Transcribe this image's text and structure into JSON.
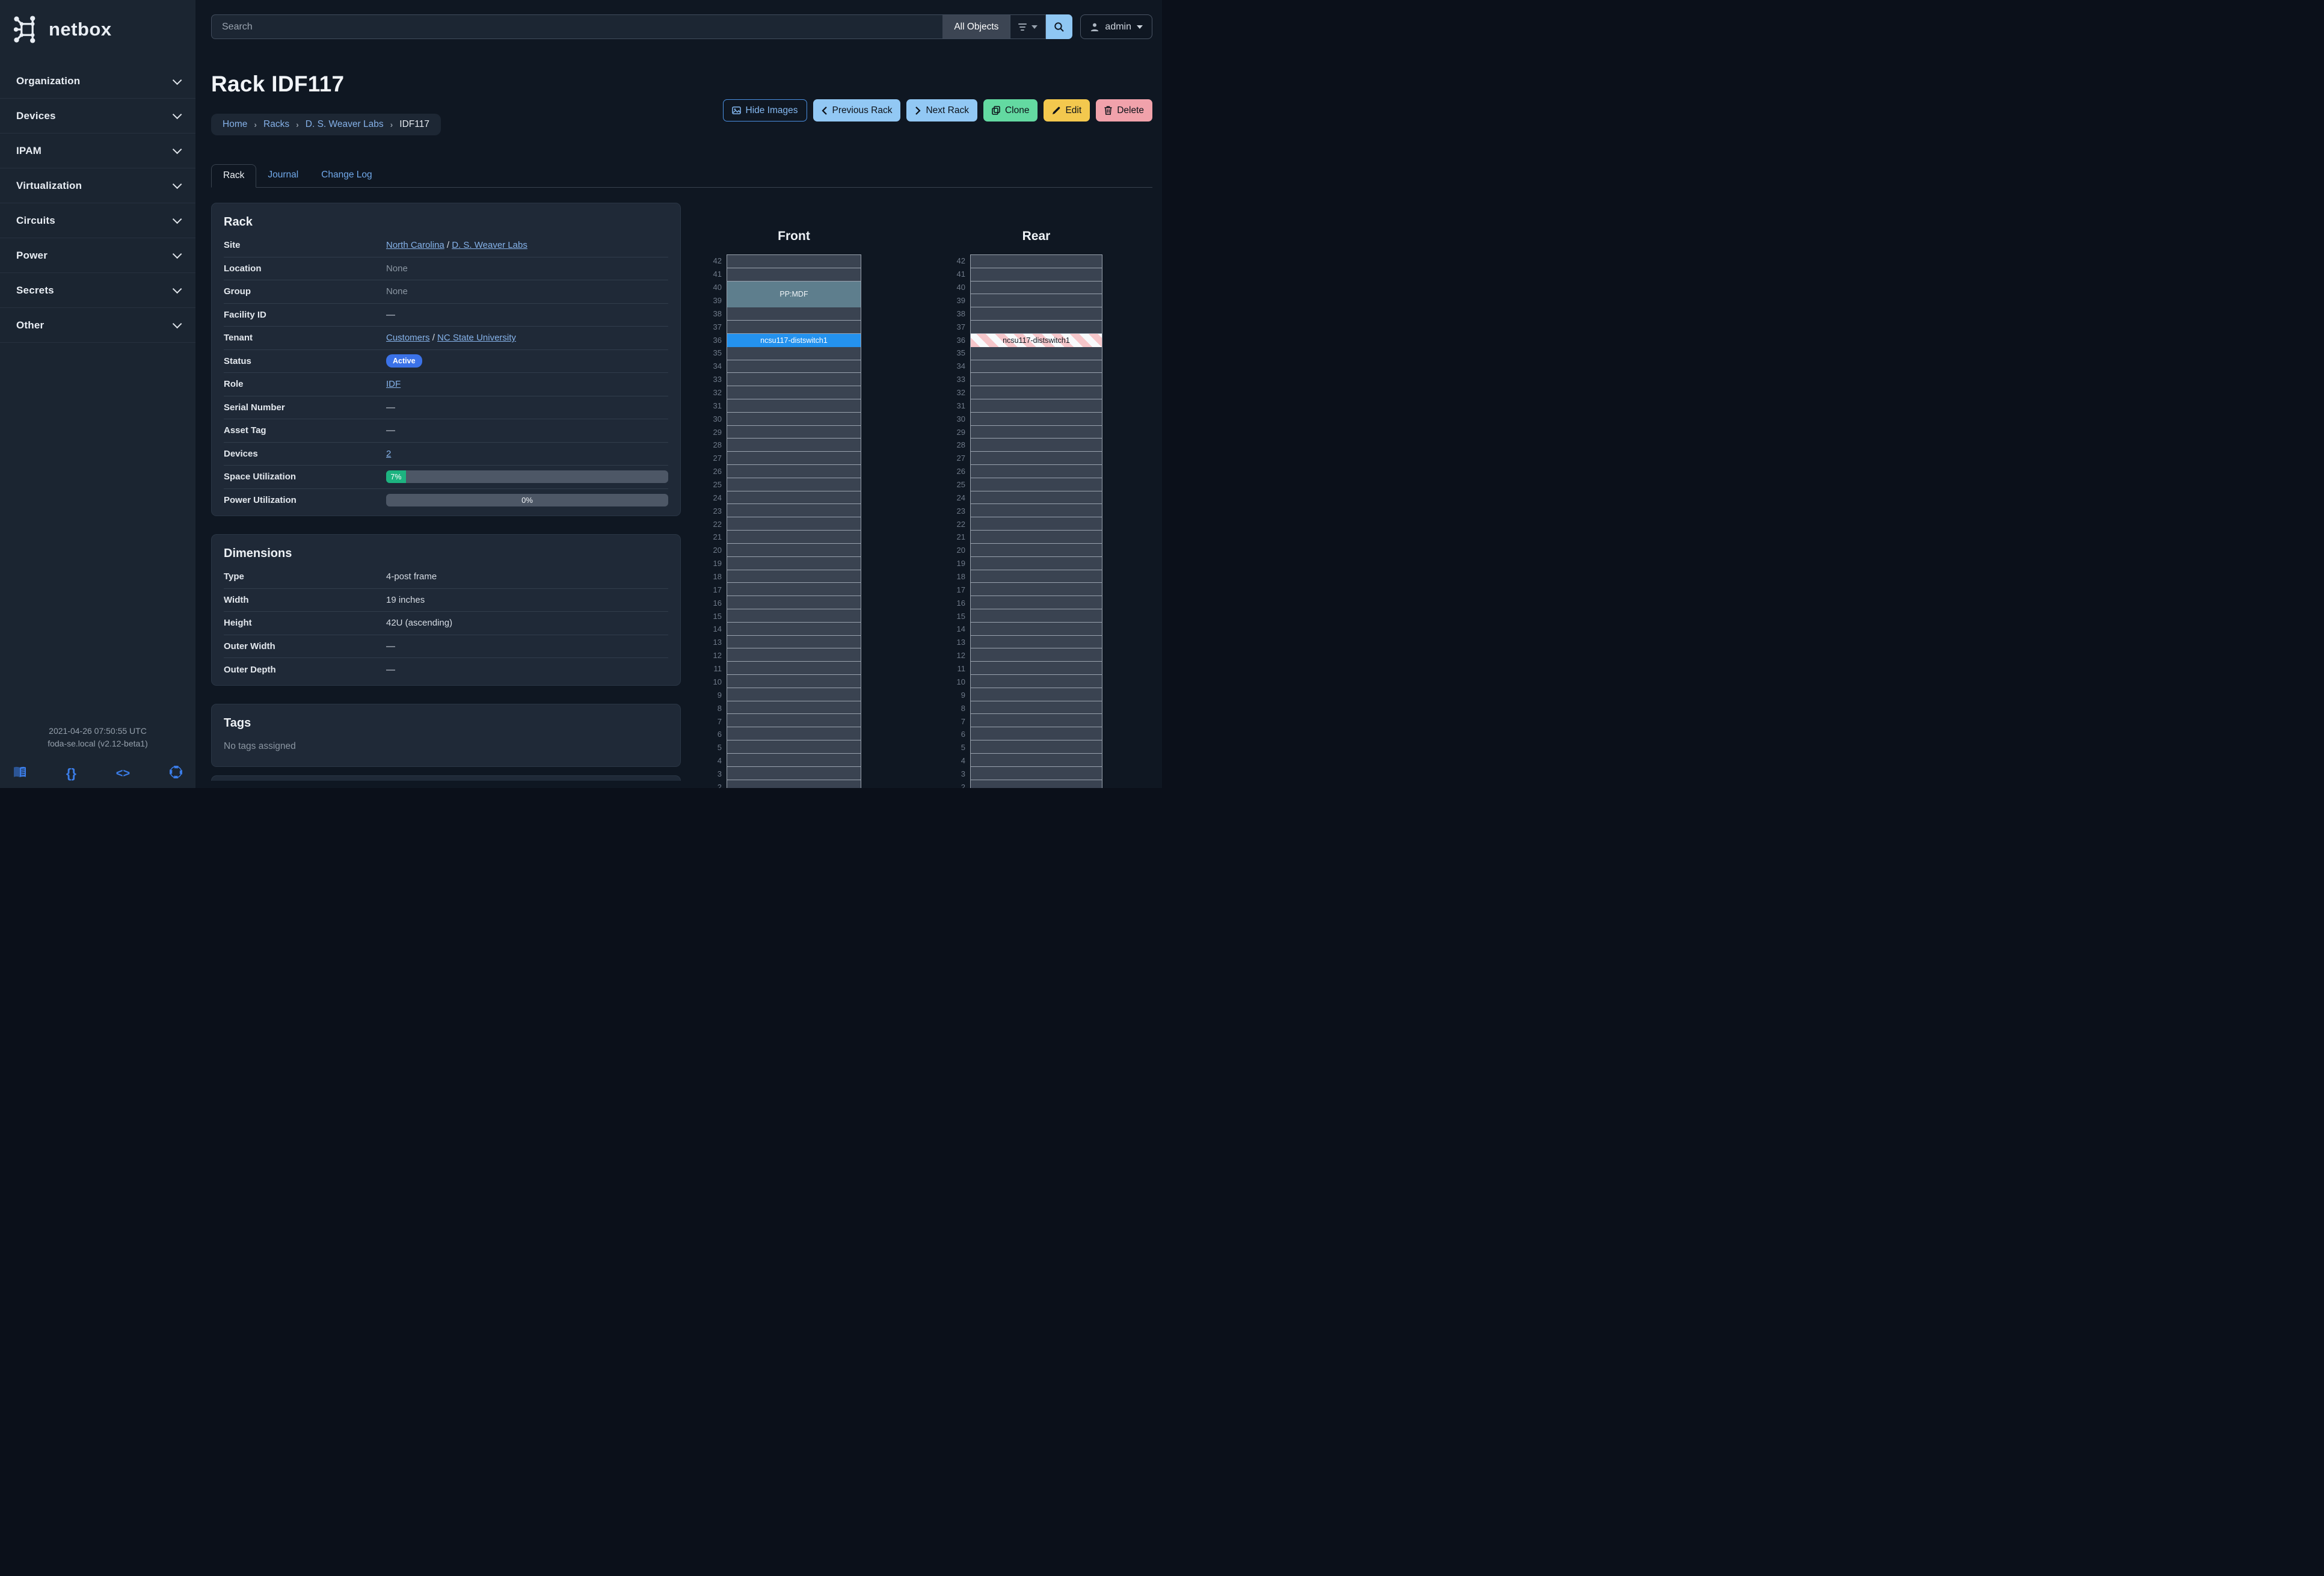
{
  "app": {
    "name": "netbox"
  },
  "sidebar": {
    "items": [
      {
        "label": "Organization"
      },
      {
        "label": "Devices"
      },
      {
        "label": "IPAM"
      },
      {
        "label": "Virtualization"
      },
      {
        "label": "Circuits"
      },
      {
        "label": "Power"
      },
      {
        "label": "Secrets"
      },
      {
        "label": "Other"
      }
    ],
    "footer": {
      "time": "2021-04-26 07:50:55 UTC",
      "host": "foda-se.local (v2.12-beta1)",
      "icons": [
        "docs-book",
        "api-braces",
        "source-code",
        "help-lifebuoy"
      ]
    }
  },
  "topbar": {
    "search_placeholder": "Search",
    "scope": "All Objects",
    "user": "admin"
  },
  "page": {
    "title": "Rack IDF117",
    "breadcrumb": {
      "separator": "›",
      "items": [
        {
          "label": "Home",
          "link": true
        },
        {
          "label": "Racks",
          "link": true
        },
        {
          "label": "D. S. Weaver Labs",
          "link": true
        },
        {
          "label": "IDF117",
          "link": false
        }
      ]
    },
    "actions": [
      {
        "label": "Hide Images",
        "variant": "outline-primary",
        "icon": "images"
      },
      {
        "label": "Previous Rack",
        "variant": "primary",
        "icon": "chevron-left"
      },
      {
        "label": "Next Rack",
        "variant": "primary",
        "icon": "chevron-right"
      },
      {
        "label": "Clone",
        "variant": "success",
        "icon": "copy"
      },
      {
        "label": "Edit",
        "variant": "warning",
        "icon": "pencil"
      },
      {
        "label": "Delete",
        "variant": "danger",
        "icon": "trash"
      }
    ],
    "tabs": [
      {
        "label": "Rack",
        "active": true
      },
      {
        "label": "Journal",
        "active": false
      },
      {
        "label": "Change Log",
        "active": false
      }
    ]
  },
  "panels": {
    "rack": {
      "title": "Rack",
      "rows": [
        {
          "label": "Site",
          "type": "links",
          "parts": [
            "North Carolina",
            "D. S. Weaver Labs"
          ],
          "separator": " / "
        },
        {
          "label": "Location",
          "type": "muted",
          "value": "None"
        },
        {
          "label": "Group",
          "type": "muted",
          "value": "None"
        },
        {
          "label": "Facility ID",
          "type": "text",
          "value": "—"
        },
        {
          "label": "Tenant",
          "type": "links",
          "parts": [
            "Customers",
            "NC State University"
          ],
          "separator": " / "
        },
        {
          "label": "Status",
          "type": "badge",
          "value": "Active",
          "color": "#3b72e8"
        },
        {
          "label": "Role",
          "type": "links",
          "parts": [
            "IDF"
          ]
        },
        {
          "label": "Serial Number",
          "type": "text",
          "value": "—"
        },
        {
          "label": "Asset Tag",
          "type": "text",
          "value": "—"
        },
        {
          "label": "Devices",
          "type": "links",
          "parts": [
            "2"
          ]
        },
        {
          "label": "Space Utilization",
          "type": "progress",
          "percent": 7,
          "text": "7%",
          "bar_color": "#1db380",
          "label_position": "inside"
        },
        {
          "label": "Power Utilization",
          "type": "progress",
          "percent": 0,
          "text": "0%",
          "bar_color": "#4d5766",
          "label_position": "center"
        }
      ]
    },
    "dimensions": {
      "title": "Dimensions",
      "rows": [
        {
          "label": "Type",
          "type": "text",
          "value": "4-post frame"
        },
        {
          "label": "Width",
          "type": "text",
          "value": "19 inches"
        },
        {
          "label": "Height",
          "type": "text",
          "value": "42U (ascending)"
        },
        {
          "label": "Outer Width",
          "type": "text",
          "value": "—"
        },
        {
          "label": "Outer Depth",
          "type": "text",
          "value": "—"
        }
      ]
    },
    "tags": {
      "title": "Tags",
      "empty": "No tags assigned"
    }
  },
  "elevations": {
    "units": 42,
    "front": {
      "title": "Front",
      "devices": [
        {
          "name": "PP:MDF",
          "top_unit": 40,
          "u_height": 2,
          "color": "#5e7e8d",
          "text_color": "#f1f5f8"
        },
        {
          "name": "ncsu117-distswitch1",
          "top_unit": 36,
          "u_height": 1,
          "color": "#2492ee",
          "text_color": "#ffffff"
        }
      ]
    },
    "rear": {
      "title": "Rear",
      "devices": [
        {
          "name": "ncsu117-distswitch1",
          "top_unit": 36,
          "u_height": 1,
          "striped": true,
          "stripe_colors": [
            "#f6c6ca",
            "#f8fafc"
          ],
          "text_color": "#131922"
        }
      ]
    }
  },
  "colors": {
    "accent_blue": "#2492ee",
    "link_blue": "#85b1e8",
    "status_active": "#3b72e8",
    "utilization_green": "#1db380",
    "rack_empty": "#3a4351",
    "rack_border": "#9aa3af"
  }
}
